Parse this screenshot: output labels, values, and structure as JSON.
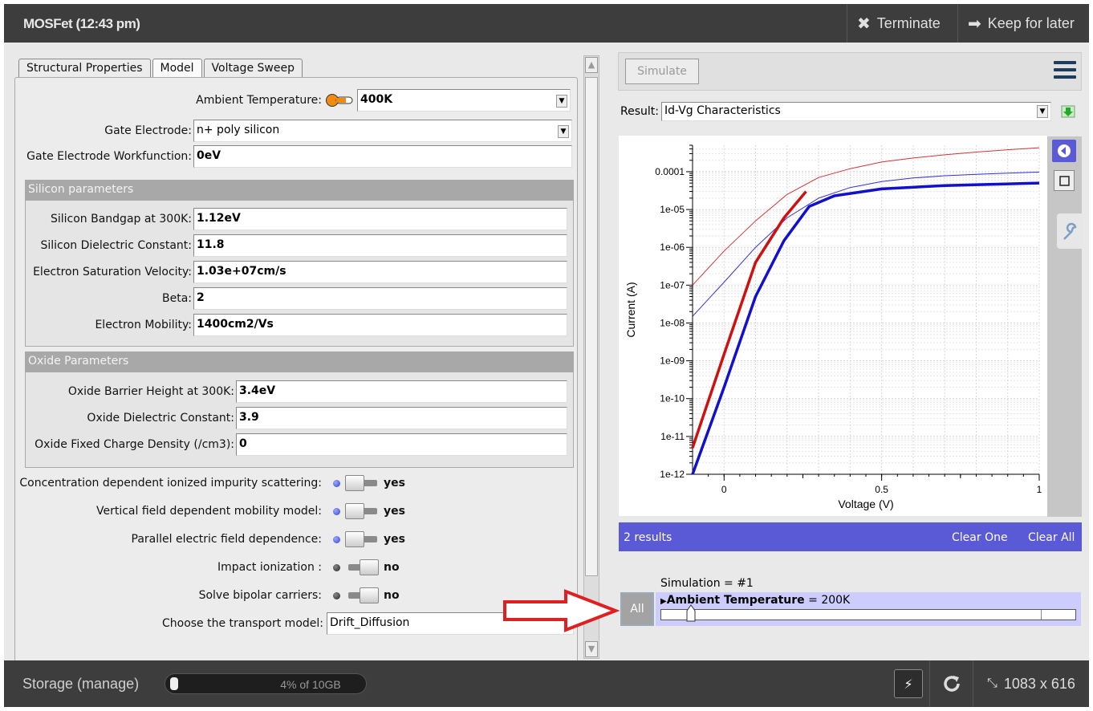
{
  "window": {
    "title": "MOSFet (12:43 pm)",
    "terminate_label": "Terminate",
    "keep_label": "Keep for later"
  },
  "tabs": [
    {
      "label": "Structural Properties",
      "active": false
    },
    {
      "label": "Model",
      "active": true
    },
    {
      "label": "Voltage Sweep",
      "active": false
    }
  ],
  "form": {
    "ambient_temperature": {
      "label": "Ambient Temperature:",
      "value": "400K"
    },
    "gate_electrode": {
      "label": "Gate Electrode:",
      "value": "n+ poly silicon"
    },
    "gate_workfunction": {
      "label": "Gate Electrode Workfunction:",
      "value": "0eV"
    },
    "silicon_section": "Silicon parameters",
    "silicon": [
      {
        "label": "Silicon Bandgap at 300K:",
        "value": "1.12eV"
      },
      {
        "label": "Silicon Dielectric Constant:",
        "value": "11.8"
      },
      {
        "label": "Electron Saturation Velocity:",
        "value": "1.03e+07cm/s"
      },
      {
        "label": "Beta:",
        "value": "2"
      },
      {
        "label": "Electron Mobility:",
        "value": "1400cm2/Vs"
      }
    ],
    "oxide_section": "Oxide Parameters",
    "oxide": [
      {
        "label": "Oxide Barrier Height at 300K:",
        "value": "3.4eV"
      },
      {
        "label": "Oxide Dielectric Constant:",
        "value": "3.9"
      },
      {
        "label": "Oxide Fixed Charge Density (/cm3):",
        "value": "0"
      }
    ],
    "toggles": [
      {
        "label": "Concentration dependent ionized impurity scattering:",
        "state": "yes",
        "on": true
      },
      {
        "label": "Vertical field dependent mobility model:",
        "state": "yes",
        "on": true
      },
      {
        "label": "Parallel electric field dependence:",
        "state": "yes",
        "on": true
      },
      {
        "label": "Impact ionization :",
        "state": "no",
        "on": false
      },
      {
        "label": "Solve bipolar carriers:",
        "state": "no",
        "on": false
      }
    ],
    "transport": {
      "label": "Choose the transport model:",
      "value": "Drift_Diffusion"
    }
  },
  "right": {
    "simulate_label": "Simulate",
    "result_label": "Result:",
    "result_value": "Id-Vg Characteristics",
    "results_count": "2 results",
    "clear_one": "Clear One",
    "clear_all": "Clear All",
    "simulation_label": "Simulation = #1",
    "all_label": "All",
    "param_name": "Ambient Temperature",
    "param_value": " = 200K"
  },
  "colors": {
    "accent_blue": "#5a5ad6",
    "series_red": "#cc1111",
    "series_blue": "#1111cc"
  },
  "chart_data": {
    "type": "line",
    "title": "",
    "xlabel": "Voltage (V)",
    "ylabel": "Current (A)",
    "xlim": [
      -0.1,
      1.0
    ],
    "ylim": [
      1e-12,
      0.0005
    ],
    "yscale": "log",
    "x_ticks": [
      "0",
      "0.5",
      "1"
    ],
    "y_ticks": [
      "0.0001",
      "1e-05",
      "1e-06",
      "1e-07",
      "1e-08",
      "1e-09",
      "1e-10",
      "1e-11",
      "1e-12"
    ],
    "grid": true,
    "series": [
      {
        "style": "thin",
        "color": "#cc1111",
        "x": [
          -0.1,
          0.0,
          0.1,
          0.2,
          0.3,
          0.4,
          0.5,
          0.6,
          0.7,
          0.8,
          0.9,
          1.0
        ],
        "y": [
          1e-07,
          8e-07,
          5e-06,
          2.5e-05,
          7e-05,
          0.00012,
          0.00018,
          0.00023,
          0.00028,
          0.00033,
          0.00038,
          0.00043
        ]
      },
      {
        "style": "thin",
        "color": "#1111cc",
        "x": [
          -0.1,
          0.0,
          0.1,
          0.2,
          0.3,
          0.4,
          0.5,
          0.6,
          0.7,
          0.8,
          0.9,
          1.0
        ],
        "y": [
          1.5e-08,
          1.2e-07,
          1e-06,
          6e-06,
          2e-05,
          3.8e-05,
          5.5e-05,
          6.8e-05,
          7.8e-05,
          8.5e-05,
          9.2e-05,
          9.8e-05
        ]
      },
      {
        "style": "thick",
        "color": "#cc1111",
        "x": [
          -0.1,
          0.0,
          0.1,
          0.19,
          0.26
        ],
        "y": [
          5e-12,
          1.5e-09,
          4e-07,
          6e-06,
          3e-05
        ]
      },
      {
        "style": "thick",
        "color": "#1111cc",
        "x": [
          -0.1,
          0.0,
          0.1,
          0.19,
          0.27,
          0.35,
          0.5,
          0.7,
          1.0
        ],
        "y": [
          1e-12,
          2e-10,
          5e-08,
          1.5e-06,
          1.2e-05,
          2.3e-05,
          3.5e-05,
          4.3e-05,
          5e-05
        ]
      }
    ]
  },
  "footer": {
    "storage_label": "Storage (manage)",
    "storage_text": "4% of 10GB",
    "storage_fraction": 0.04,
    "size_readout": "1083 x 616"
  }
}
